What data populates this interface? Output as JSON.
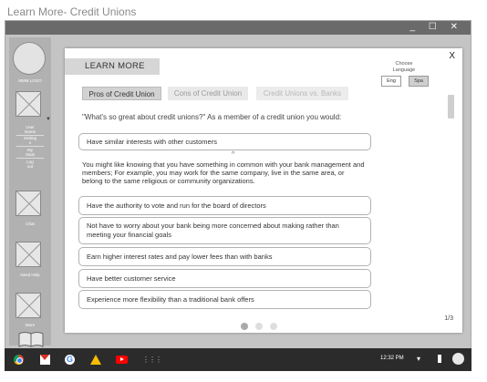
{
  "page_title": "Learn More- Credit Unions",
  "window": {
    "controls": "_ ☐ ✕"
  },
  "sidebar": {
    "logo_label": "MMM LOGO",
    "profile_lines": [
      "User",
      "Name",
      "Setting",
      "s",
      "My",
      "Stats",
      "Log",
      "out"
    ],
    "chat_label": "Chat",
    "help_label": "Need Help",
    "more_label": "More"
  },
  "modal": {
    "header": "LEARN MORE",
    "close": "X",
    "language": {
      "label_line1": "Choose",
      "label_line2": "Language",
      "eng": "Eng",
      "spa": "Spa"
    },
    "tabs": [
      {
        "label": "Pros of Credit Union"
      },
      {
        "label": "Cons of Credit Union"
      },
      {
        "label": "Credit Unions vs. Banks"
      }
    ],
    "intro": "\"What's so great about credit unions?\" As a member of a credit union you would:",
    "items": [
      {
        "label": "Have similar interests with other customers"
      },
      {
        "label": "Have the authority to vote and run for the board of directors"
      },
      {
        "label": "Not have to worry about your bank being more concerned about making rather than meeting your financial goals"
      },
      {
        "label": "Earn higher interest rates and pay lower fees than with banks"
      },
      {
        "label": "Have better customer service"
      },
      {
        "label": "Experience more flexibility than a traditional bank offers"
      }
    ],
    "expanded_text": "You might like knowing that you have something in common with your bank management and members; For example, you may work for the same company, live in the same area, or belong to the same religious or community organizations.",
    "page_indicator": "1/3"
  },
  "taskbar": {
    "time": "12:32 PM",
    "google_letter": "G",
    "apps_icon": "⋮⋮⋮",
    "wifi": "▾"
  }
}
